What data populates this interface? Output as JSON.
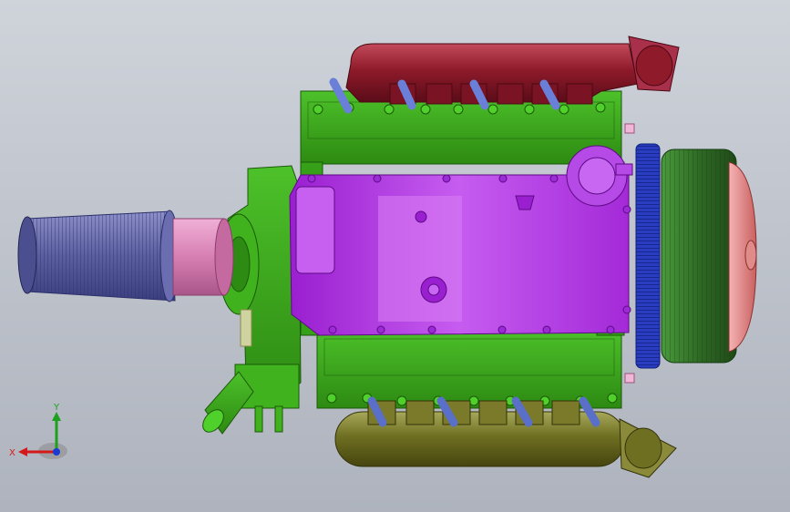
{
  "viewport": {
    "background_top": "#cfd3da",
    "background_bottom": "#aeb3bd"
  },
  "model": {
    "parts": [
      "air-filter",
      "intake-adapter",
      "timing-cover",
      "oil-pan",
      "engine-block",
      "upper-exhaust-manifold",
      "lower-exhaust-manifold",
      "flywheel",
      "clutch-housing",
      "bellhousing-flange",
      "water-outlet",
      "oil-filler"
    ],
    "colors": {
      "block": "#3aa81a",
      "oil_pan": "#b233e0",
      "upper_exhaust": "#8e1a2a",
      "lower_exhaust": "#6f6f22",
      "air_filter": "#5b5fa0",
      "intake": "#d77fb3",
      "flywheel": "#2a3cbf",
      "clutch": "#2f6a25",
      "flange": "#e48a8a",
      "runners": "#5a6fc8"
    }
  },
  "triad": {
    "y_label": "Y",
    "x_label": "X"
  }
}
